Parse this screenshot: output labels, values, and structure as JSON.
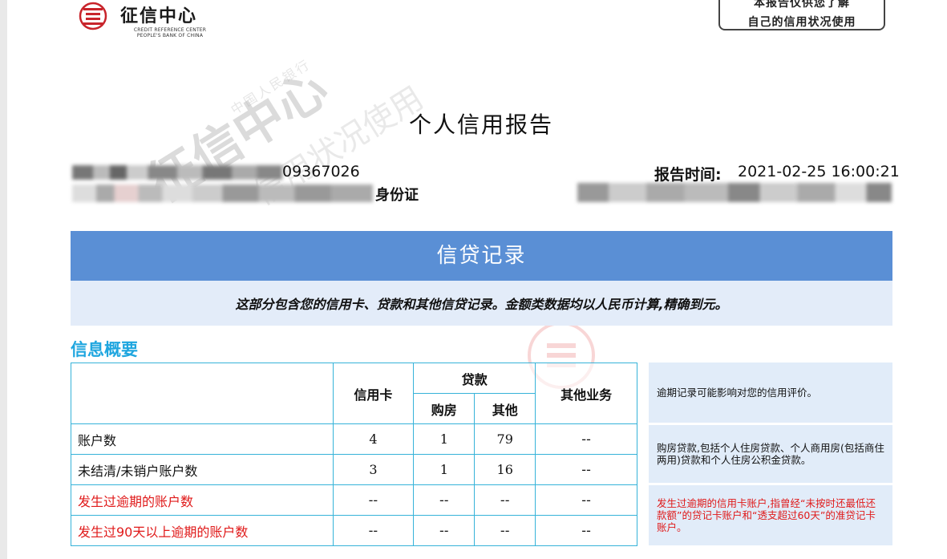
{
  "header": {
    "logo_title": "征信中心",
    "logo_en_line1": "CREDIT REFERENCE CENTER",
    "logo_en_line2": "PEOPLE'S BANK OF CHINA",
    "stamp_line1": "本报告仅供您了解",
    "stamp_line2": "自己的信用状况使用"
  },
  "watermark": {
    "big": "征信中心",
    "medium": "信用状况使用",
    "small": "中国人民银行"
  },
  "report": {
    "title": "个人信用报告",
    "report_no_suffix": "09367026",
    "id_type": "身份证",
    "report_time_label": "报告时间:",
    "report_time": "2021-02-25 16:00:21"
  },
  "section": {
    "title": "信贷记录",
    "subtitle": "这部分包含您的信用卡、贷款和其他信贷记录。金额类数据均以人民币计算,精确到元。",
    "summary_heading": "信息概要"
  },
  "table": {
    "headers": {
      "credit_card": "信用卡",
      "loan": "贷款",
      "housing": "购房",
      "other": "其他",
      "other_business": "其他业务"
    },
    "rows": [
      {
        "label": "账户数",
        "credit_card": "4",
        "housing": "1",
        "other": "79",
        "other_business": "--"
      },
      {
        "label": "未结清/未销户账户数",
        "credit_card": "3",
        "housing": "1",
        "other": "16",
        "other_business": "--"
      },
      {
        "label": "发生过逾期的账户数",
        "credit_card": "--",
        "housing": "--",
        "other": "--",
        "other_business": "--"
      },
      {
        "label": "发生过90天以上逾期的账户数",
        "credit_card": "--",
        "housing": "--",
        "other": "--",
        "other_business": "--"
      }
    ]
  },
  "notes": [
    "逾期记录可能影响对您的信用评价。",
    "购房贷款,包括个人住房贷款、个人商用房(包括商住两用)贷款和个人住房公积金贷款。",
    "发生过逾期的信用卡账户,指曾经“未按时还最低还款额”的贷记卡账户和“透支超过60天”的准贷记卡账户。"
  ],
  "colors": {
    "banner": "#5a8fd5",
    "banner_sub": "#e3ecf9",
    "heading": "#1fa6df",
    "table_border": "#36b3d9",
    "alert": "#e01a1a"
  }
}
